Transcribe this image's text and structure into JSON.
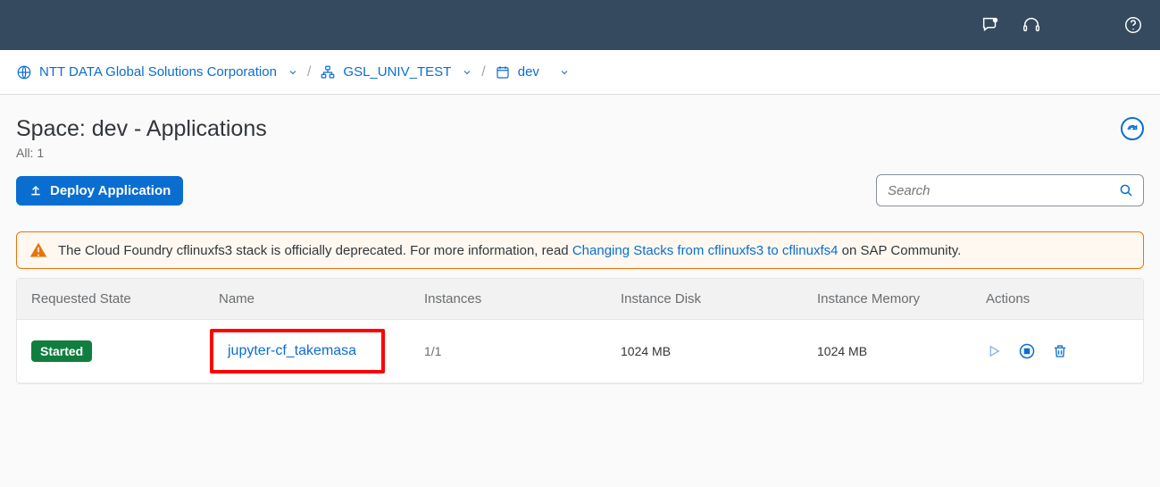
{
  "breadcrumb": {
    "org": "NTT DATA Global Solutions Corporation",
    "subaccount": "GSL_UNIV_TEST",
    "space": "dev"
  },
  "page": {
    "title": "Space: dev - Applications",
    "count_label": "All: 1"
  },
  "toolbar": {
    "deploy_label": "Deploy Application",
    "search_placeholder": "Search"
  },
  "warning": {
    "text_before_link": "The Cloud Foundry cflinuxfs3 stack is officially deprecated. For more information, read ",
    "link_text": "Changing Stacks from cflinuxfs3 to cflinuxfs4",
    "text_after_link": " on SAP Community."
  },
  "table": {
    "headers": {
      "state": "Requested State",
      "name": "Name",
      "instances": "Instances",
      "disk": "Instance Disk",
      "memory": "Instance Memory",
      "actions": "Actions"
    },
    "rows": [
      {
        "state": "Started",
        "name": "jupyter-cf_takemasa",
        "instances": "1/1",
        "disk": "1024 MB",
        "memory": "1024 MB"
      }
    ]
  }
}
